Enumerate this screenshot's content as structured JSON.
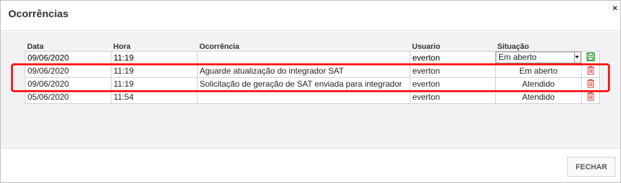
{
  "dialog": {
    "title": "Ocorrências",
    "close_glyph": "×",
    "close_button": "×"
  },
  "table": {
    "headers": {
      "data": "Data",
      "hora": "Hora",
      "ocorrencia": "Ocorrência",
      "usuario": "Usuario",
      "situacao": "Situação"
    },
    "new_row": {
      "data": "09/06/2020",
      "hora": "11:19",
      "ocorrencia": "",
      "usuario": "everton",
      "situacao": "Em aberto",
      "action_icon": "save-icon"
    },
    "rows": [
      {
        "data": "09/06/2020",
        "hora": "11:19",
        "ocorrencia": "Aguarde atualização do integrador SAT",
        "usuario": "everton",
        "situacao": "Em aberto",
        "action_icon": "trash-icon"
      },
      {
        "data": "09/06/2020",
        "hora": "11:19",
        "ocorrencia": "Solicitação de geração de SAT enviada para integrador",
        "usuario": "everton",
        "situacao": "Atendido",
        "action_icon": "trash-icon"
      },
      {
        "data": "05/06/2020",
        "hora": "11:54",
        "ocorrencia": "",
        "usuario": "everton",
        "situacao": "Atendido",
        "action_icon": "trash-icon"
      }
    ]
  },
  "footer": {
    "close_label": "FECHAR"
  },
  "colors": {
    "highlight": "#ff1a1a",
    "save_icon": "#2e9a2e",
    "trash_icon": "#e04848"
  }
}
